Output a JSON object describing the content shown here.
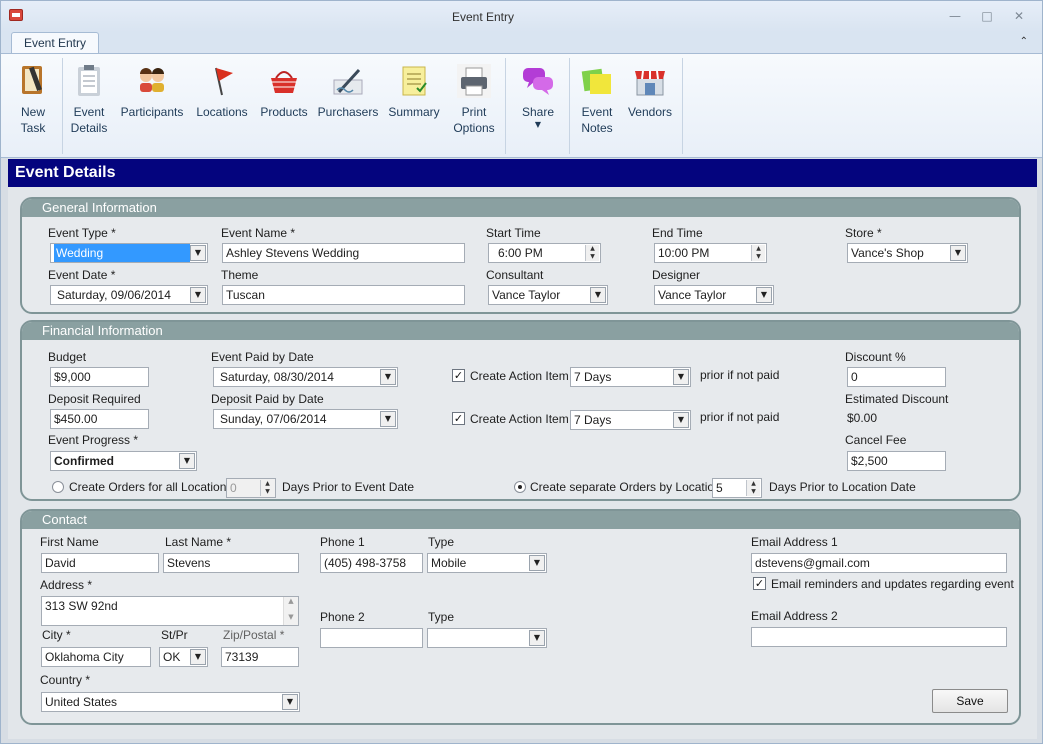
{
  "window": {
    "title": "Event Entry"
  },
  "tabs": [
    {
      "label": "Event Entry"
    }
  ],
  "ribbon": {
    "new_task": "New\nTask",
    "event_details": "Event\nDetails",
    "participants": "Participants",
    "locations": "Locations",
    "products": "Products",
    "purchasers": "Purchasers",
    "summary": "Summary",
    "print_options": "Print\nOptions",
    "share": "Share",
    "event_notes": "Event\nNotes",
    "vendors": "Vendors"
  },
  "section_title": "Event Details",
  "general": {
    "title": "General Information",
    "event_type_label": "Event Type *",
    "event_type_value": "Wedding",
    "event_name_label": "Event Name *",
    "event_name_value": "Ashley Stevens Wedding",
    "start_time_label": "Start Time",
    "start_time_value": "6:00 PM",
    "end_time_label": "End Time",
    "end_time_value": "10:00 PM",
    "store_label": "Store *",
    "store_value": "Vance's Shop",
    "event_date_label": "Event Date *",
    "event_date_value": "Saturday, 09/06/2014",
    "theme_label": "Theme",
    "theme_value": "Tuscan",
    "consultant_label": "Consultant",
    "consultant_value": "Vance Taylor",
    "designer_label": "Designer",
    "designer_value": "Vance Taylor"
  },
  "financial": {
    "title": "Financial Information",
    "budget_label": "Budget",
    "budget_value": "$9,000",
    "event_paid_by_label": "Event Paid by Date",
    "event_paid_by_value": "Saturday, 08/30/2014",
    "create_action_label": "Create Action Item",
    "action1_value": "7 Days",
    "prior_text": "prior if not paid",
    "discount_label": "Discount %",
    "discount_value": "0",
    "deposit_label": "Deposit Required",
    "deposit_value": "$450.00",
    "deposit_paid_by_label": "Deposit Paid by Date",
    "deposit_paid_by_value": "Sunday, 07/06/2014",
    "action2_value": "7 Days",
    "est_discount_label": "Estimated Discount",
    "est_discount_value": "$0.00",
    "progress_label": "Event Progress *",
    "progress_value": "Confirmed",
    "cancel_fee_label": "Cancel Fee",
    "cancel_fee_value": "$2,500",
    "orders_all_label": "Create Orders for all Locations",
    "orders_all_value": "0",
    "days_prior_event": "Days Prior to Event Date",
    "orders_sep_label": "Create separate Orders by Location",
    "orders_sep_value": "5",
    "days_prior_location": "Days Prior to Location Date"
  },
  "contact": {
    "title": "Contact",
    "first_name_label": "First Name",
    "first_name_value": "David",
    "last_name_label": "Last Name *",
    "last_name_value": "Stevens",
    "phone1_label": "Phone 1",
    "phone1_value": "(405) 498-3758",
    "type_label": "Type",
    "type1_value": "Mobile",
    "email1_label": "Email Address 1",
    "email1_value": "dstevens@gmail.com",
    "address_label": "Address *",
    "address_value": "313 SW 92nd",
    "email_reminders": "Email reminders and updates regarding event",
    "phone2_label": "Phone 2",
    "phone2_value": "",
    "type2_value": "",
    "email2_label": "Email Address 2",
    "email2_value": "",
    "city_label": "City *",
    "city_value": "Oklahoma City",
    "state_label": "St/Pr",
    "state_value": "OK",
    "zip_label": "Zip/Postal *",
    "zip_value": "73139",
    "country_label": "Country *",
    "country_value": "United States",
    "save_label": "Save"
  }
}
